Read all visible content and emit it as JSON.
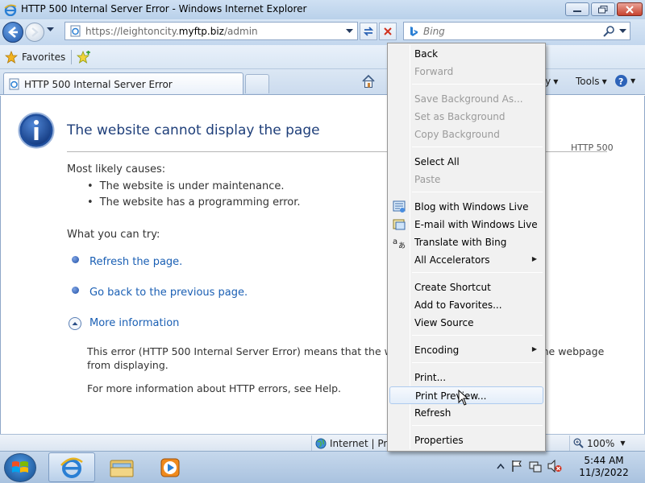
{
  "window": {
    "title": "HTTP 500 Internal Server Error - Windows Internet Explorer"
  },
  "address_bar": {
    "url_prefix": "https://leightoncity.",
    "url_domain": "myftp.biz",
    "url_suffix": "/admin"
  },
  "search": {
    "placeholder": "Bing"
  },
  "favorites_bar": {
    "favorites_label": "Favorites"
  },
  "tabs": {
    "active_label": "HTTP 500 Internal Server Error"
  },
  "command_bar": {
    "safety_label": "ety",
    "tools_label": "Tools"
  },
  "page": {
    "title": "The website cannot display the page",
    "http_code": "HTTP 500",
    "causes_label": "Most likely causes:",
    "causes": [
      "The website is under maintenance.",
      "The website has a programming error."
    ],
    "try_label": "What you can try:",
    "actions": [
      "Refresh the page.",
      "Go back to the previous page."
    ],
    "more_info_label": "More information",
    "detail_text": "This error (HTTP 500 Internal Server Error) means that the websi                                                        oblem which prevented the webpage from displaying.",
    "help_text": "For more information about HTTP errors, see Help."
  },
  "status_bar": {
    "zone_label": "Internet | Prot",
    "zoom_label": "100%"
  },
  "context_menu": {
    "items": [
      {
        "label": "Back",
        "enabled": true
      },
      {
        "label": "Forward",
        "enabled": false
      },
      {
        "label": "Save Background As...",
        "enabled": false
      },
      {
        "label": "Set as Background",
        "enabled": false
      },
      {
        "label": "Copy Background",
        "enabled": false
      },
      {
        "label": "Select All",
        "enabled": true
      },
      {
        "label": "Paste",
        "enabled": false
      },
      {
        "label": "Blog with Windows Live",
        "enabled": true,
        "icon": "blog-icon"
      },
      {
        "label": "E-mail with Windows Live",
        "enabled": true,
        "icon": "email-icon"
      },
      {
        "label": "Translate with Bing",
        "enabled": true,
        "icon": "translate-icon"
      },
      {
        "label": "All Accelerators",
        "enabled": true,
        "submenu": true
      },
      {
        "label": "Create Shortcut",
        "enabled": true
      },
      {
        "label": "Add to Favorites...",
        "enabled": true
      },
      {
        "label": "View Source",
        "enabled": true
      },
      {
        "label": "Encoding",
        "enabled": true,
        "submenu": true
      },
      {
        "label": "Print...",
        "enabled": true
      },
      {
        "label": "Print Preview...",
        "enabled": true,
        "hovered": true
      },
      {
        "label": "Refresh",
        "enabled": true
      },
      {
        "label": "Properties",
        "enabled": true
      }
    ]
  },
  "taskbar": {
    "clock_time": "5:44 AM",
    "clock_date": "11/3/2022"
  },
  "colors": {
    "link": "#1a5fb4",
    "title_blue": "#1f3f7a",
    "disabled_text": "#9a9a9a"
  }
}
